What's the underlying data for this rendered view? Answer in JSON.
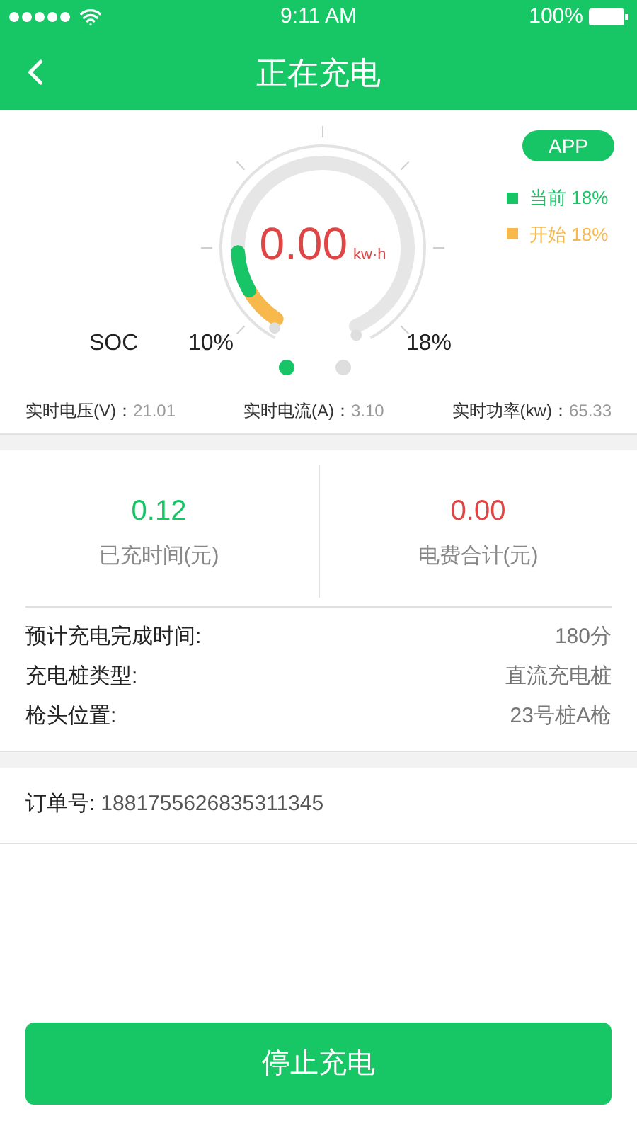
{
  "status_bar": {
    "time": "9:11 AM",
    "battery": "100%"
  },
  "header": {
    "title": "正在充电"
  },
  "gauge": {
    "value": "0.00",
    "unit": "kw·h",
    "label": "SOC",
    "start": "10%",
    "end": "18%",
    "badge": "APP",
    "legend": [
      {
        "label": "当前 18%",
        "color": "#17c466"
      },
      {
        "label": "开始 18%",
        "color": "#f8b94c"
      }
    ],
    "pages": [
      {
        "selected": true
      },
      {
        "selected": false
      }
    ]
  },
  "metrics": [
    {
      "label": "实时电压(V)：",
      "value": "21.01"
    },
    {
      "label": "实时电流(A)：",
      "value": "3.10"
    },
    {
      "label": "实时功率(kw)：",
      "value": "65.33"
    }
  ],
  "totals": [
    {
      "kind": "time",
      "value": "0.12",
      "label": "已充时间(元)"
    },
    {
      "kind": "cost",
      "value": "0.00",
      "label": "电费合计(元)"
    }
  ],
  "details": [
    {
      "label": "预计充电完成时间:",
      "value": "180分"
    },
    {
      "label": "充电桩类型:",
      "value": "直流充电桩"
    },
    {
      "label": "枪头位置:",
      "value": "23号桩A枪"
    }
  ],
  "order": {
    "label": "订单号:",
    "value": "1881755626835311345"
  },
  "stop_button": "停止充电"
}
